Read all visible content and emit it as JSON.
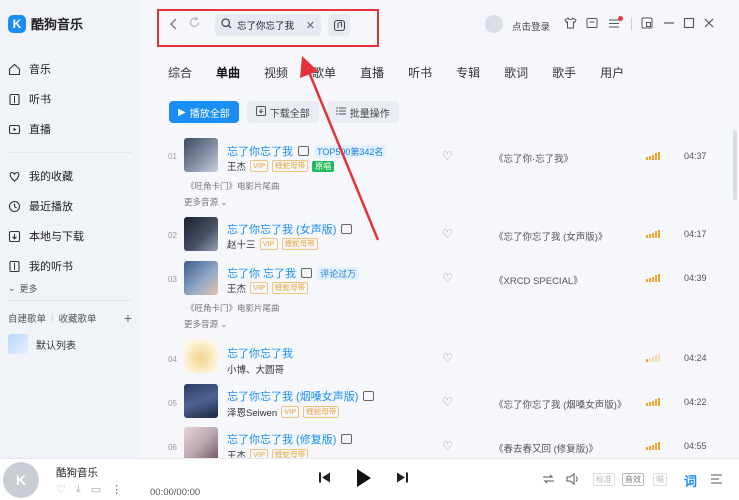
{
  "app": {
    "name": "酷狗音乐",
    "logo_letter": "K"
  },
  "sidebar": {
    "items": [
      {
        "label": "音乐",
        "icon": "home-icon"
      },
      {
        "label": "听书",
        "icon": "book-icon"
      },
      {
        "label": "直播",
        "icon": "live-icon"
      }
    ],
    "my_items": [
      {
        "label": "我的收藏",
        "icon": "heart-icon"
      },
      {
        "label": "最近播放",
        "icon": "clock-icon"
      },
      {
        "label": "本地与下载",
        "icon": "download-icon"
      },
      {
        "label": "我的听书",
        "icon": "book-icon"
      }
    ],
    "more_label": "更多",
    "playlist_tabs": {
      "created": "自建歌单",
      "collected": "收藏歌单"
    },
    "default_playlist": "默认列表"
  },
  "topbar": {
    "search_text": "忘了你忘了我",
    "login_label": "点击登录"
  },
  "tabs": [
    "综合",
    "单曲",
    "视频",
    "歌单",
    "直播",
    "听书",
    "专辑",
    "歌词",
    "歌手",
    "用户"
  ],
  "active_tab": "单曲",
  "actions": {
    "play_all": "播放全部",
    "download_all": "下载全部",
    "batch": "批量操作"
  },
  "songs": [
    {
      "index": "01",
      "title": "忘了你忘了我",
      "tag": "TOP500第342名",
      "artist": "王杰",
      "badges": [
        "VIP",
        "蝰蛇母带",
        "原唱"
      ],
      "desc": "《旺角卡门》电影片尾曲",
      "more": "更多音源",
      "album": "《忘了你·忘了我》",
      "duration": "04:37",
      "quality": 5
    },
    {
      "index": "02",
      "title": "忘了你忘了我 (女声版)",
      "tag": "",
      "artist": "赵十三",
      "badges": [
        "VIP",
        "蝰蛇母带"
      ],
      "desc": "",
      "more": "",
      "album": "《忘了你忘了我 (女声版)》",
      "duration": "04:17",
      "quality": 5
    },
    {
      "index": "03",
      "title": "忘了你 忘了我",
      "tag": "评论过万",
      "artist": "王杰",
      "badges": [
        "VIP",
        "蝰蛇母带"
      ],
      "desc": "《旺角卡门》电影片尾曲",
      "more": "更多音源",
      "album": "《XRCD SPECIAL》",
      "duration": "04:39",
      "quality": 5
    },
    {
      "index": "04",
      "title": "忘了你忘了我",
      "tag": "",
      "artist": "小博、大圆哥",
      "badges": [],
      "desc": "",
      "more": "",
      "album": "",
      "duration": "04:24",
      "quality": 1
    },
    {
      "index": "05",
      "title": "忘了你忘了我 (烟嗓女声版)",
      "tag": "",
      "artist": "泽恩Seiwen",
      "badges": [
        "VIP",
        "蝰蛇母带"
      ],
      "desc": "",
      "more": "",
      "album": "《忘了你忘了我 (烟嗓女声版)》",
      "duration": "04:22",
      "quality": 5
    },
    {
      "index": "06",
      "title": "忘了你忘了我 (修复版)",
      "tag": "",
      "artist": "王杰",
      "badges": [
        "VIP",
        "蝰蛇母带"
      ],
      "desc": "",
      "more": "",
      "album": "《春去春又回 (修复版)》",
      "duration": "04:55",
      "quality": 5
    }
  ],
  "player": {
    "title": "酷狗音乐",
    "time": "00:00/00:00",
    "quality_pill": "标准",
    "effect_pill": "音效",
    "sing_pill": "唱",
    "lyric": "词"
  },
  "colors": {
    "accent": "#1a8ef5",
    "highlight": "#e3323a"
  }
}
